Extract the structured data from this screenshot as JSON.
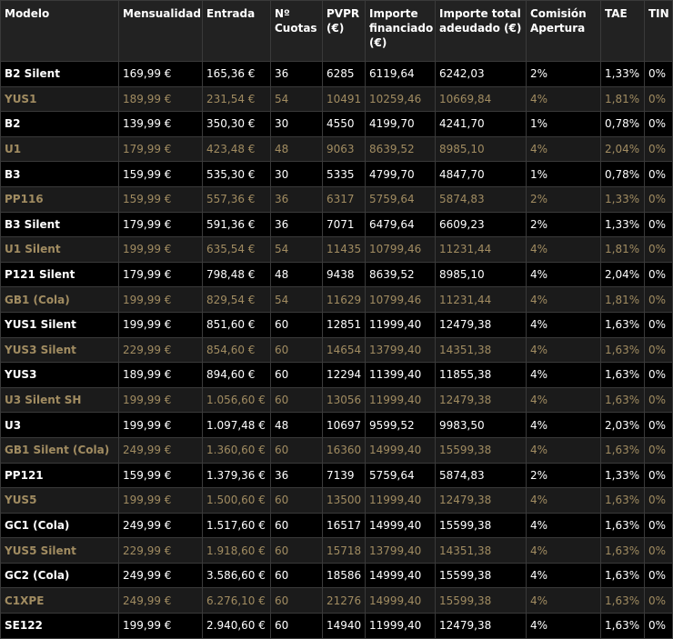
{
  "headers": [
    "Modelo",
    "Mensualidad",
    "Entrada",
    "Nº Cuotas",
    "PVPR (€)",
    "Importe financiado (€)",
    "Importe total adeudado (€)",
    "Comisión Apertura",
    "TAE",
    "TIN"
  ],
  "rows": [
    [
      "B2 Silent",
      "169,99 €",
      "165,36 €",
      "36",
      "6285",
      "6119,64",
      "6242,03",
      "2%",
      "1,33%",
      "0%"
    ],
    [
      "YUS1",
      "189,99 €",
      "231,54 €",
      "54",
      "10491",
      "10259,46",
      "10669,84",
      "4%",
      "1,81%",
      "0%"
    ],
    [
      "B2",
      "139,99 €",
      "350,30 €",
      "30",
      "4550",
      "4199,70",
      "4241,70",
      "1%",
      "0,78%",
      "0%"
    ],
    [
      "U1",
      "179,99 €",
      "423,48 €",
      "48",
      "9063",
      "8639,52",
      "8985,10",
      "4%",
      "2,04%",
      "0%"
    ],
    [
      "B3",
      "159,99 €",
      "535,30 €",
      "30",
      "5335",
      "4799,70",
      "4847,70",
      "1%",
      "0,78%",
      "0%"
    ],
    [
      "PP116",
      "159,99 €",
      "557,36 €",
      "36",
      "6317",
      "5759,64",
      "5874,83",
      "2%",
      "1,33%",
      "0%"
    ],
    [
      "B3 Silent",
      "179,99 €",
      "591,36 €",
      "36",
      "7071",
      "6479,64",
      "6609,23",
      "2%",
      "1,33%",
      "0%"
    ],
    [
      "U1 Silent",
      "199,99 €",
      "635,54 €",
      "54",
      "11435",
      "10799,46",
      "11231,44",
      "4%",
      "1,81%",
      "0%"
    ],
    [
      "P121 Silent",
      "179,99 €",
      "798,48 €",
      "48",
      "9438",
      "8639,52",
      "8985,10",
      "4%",
      "2,04%",
      "0%"
    ],
    [
      "GB1 (Cola)",
      "199,99 €",
      "829,54 €",
      "54",
      "11629",
      "10799,46",
      "11231,44",
      "4%",
      "1,81%",
      "0%"
    ],
    [
      "YUS1 Silent",
      "199,99 €",
      "851,60 €",
      "60",
      "12851",
      "11999,40",
      "12479,38",
      "4%",
      "1,63%",
      "0%"
    ],
    [
      "YUS3 Silent",
      "229,99 €",
      "854,60 €",
      "60",
      "14654",
      "13799,40",
      "14351,38",
      "4%",
      "1,63%",
      "0%"
    ],
    [
      "YUS3",
      "189,99 €",
      "894,60 €",
      "60",
      "12294",
      "11399,40",
      "11855,38",
      "4%",
      "1,63%",
      "0%"
    ],
    [
      "U3 Silent SH",
      "199,99 €",
      "1.056,60 €",
      "60",
      "13056",
      "11999,40",
      "12479,38",
      "4%",
      "1,63%",
      "0%"
    ],
    [
      "U3",
      "199,99 €",
      "1.097,48 €",
      "48",
      "10697",
      "9599,52",
      "9983,50",
      "4%",
      "2,03%",
      "0%"
    ],
    [
      "GB1 Silent (Cola)",
      "249,99 €",
      "1.360,60 €",
      "60",
      "16360",
      "14999,40",
      "15599,38",
      "4%",
      "1,63%",
      "0%"
    ],
    [
      "PP121",
      "159,99 €",
      "1.379,36 €",
      "36",
      "7139",
      "5759,64",
      "5874,83",
      "2%",
      "1,33%",
      "0%"
    ],
    [
      "YUS5",
      "199,99 €",
      "1.500,60 €",
      "60",
      "13500",
      "11999,40",
      "12479,38",
      "4%",
      "1,63%",
      "0%"
    ],
    [
      "GC1 (Cola)",
      "249,99 €",
      "1.517,60 €",
      "60",
      "16517",
      "14999,40",
      "15599,38",
      "4%",
      "1,63%",
      "0%"
    ],
    [
      "YUS5 Silent",
      "229,99 €",
      "1.918,60 €",
      "60",
      "15718",
      "13799,40",
      "14351,38",
      "4%",
      "1,63%",
      "0%"
    ],
    [
      "GC2 (Cola)",
      "249,99 €",
      "3.586,60 €",
      "60",
      "18586",
      "14999,40",
      "15599,38",
      "4%",
      "1,63%",
      "0%"
    ],
    [
      "C1XPE",
      "249,99 €",
      "6.276,10 €",
      "60",
      "21276",
      "14999,40",
      "15599,38",
      "4%",
      "1,63%",
      "0%"
    ],
    [
      "SE122",
      "199,99 €",
      "2.940,60 €",
      "60",
      "14940",
      "11999,40",
      "12479,38",
      "4%",
      "1,63%",
      "0%"
    ]
  ],
  "colors": {
    "header_bg": "#222222",
    "row_text_primary": "#ffffff",
    "row_text_alt": "#a18c61",
    "background": "#000000"
  }
}
